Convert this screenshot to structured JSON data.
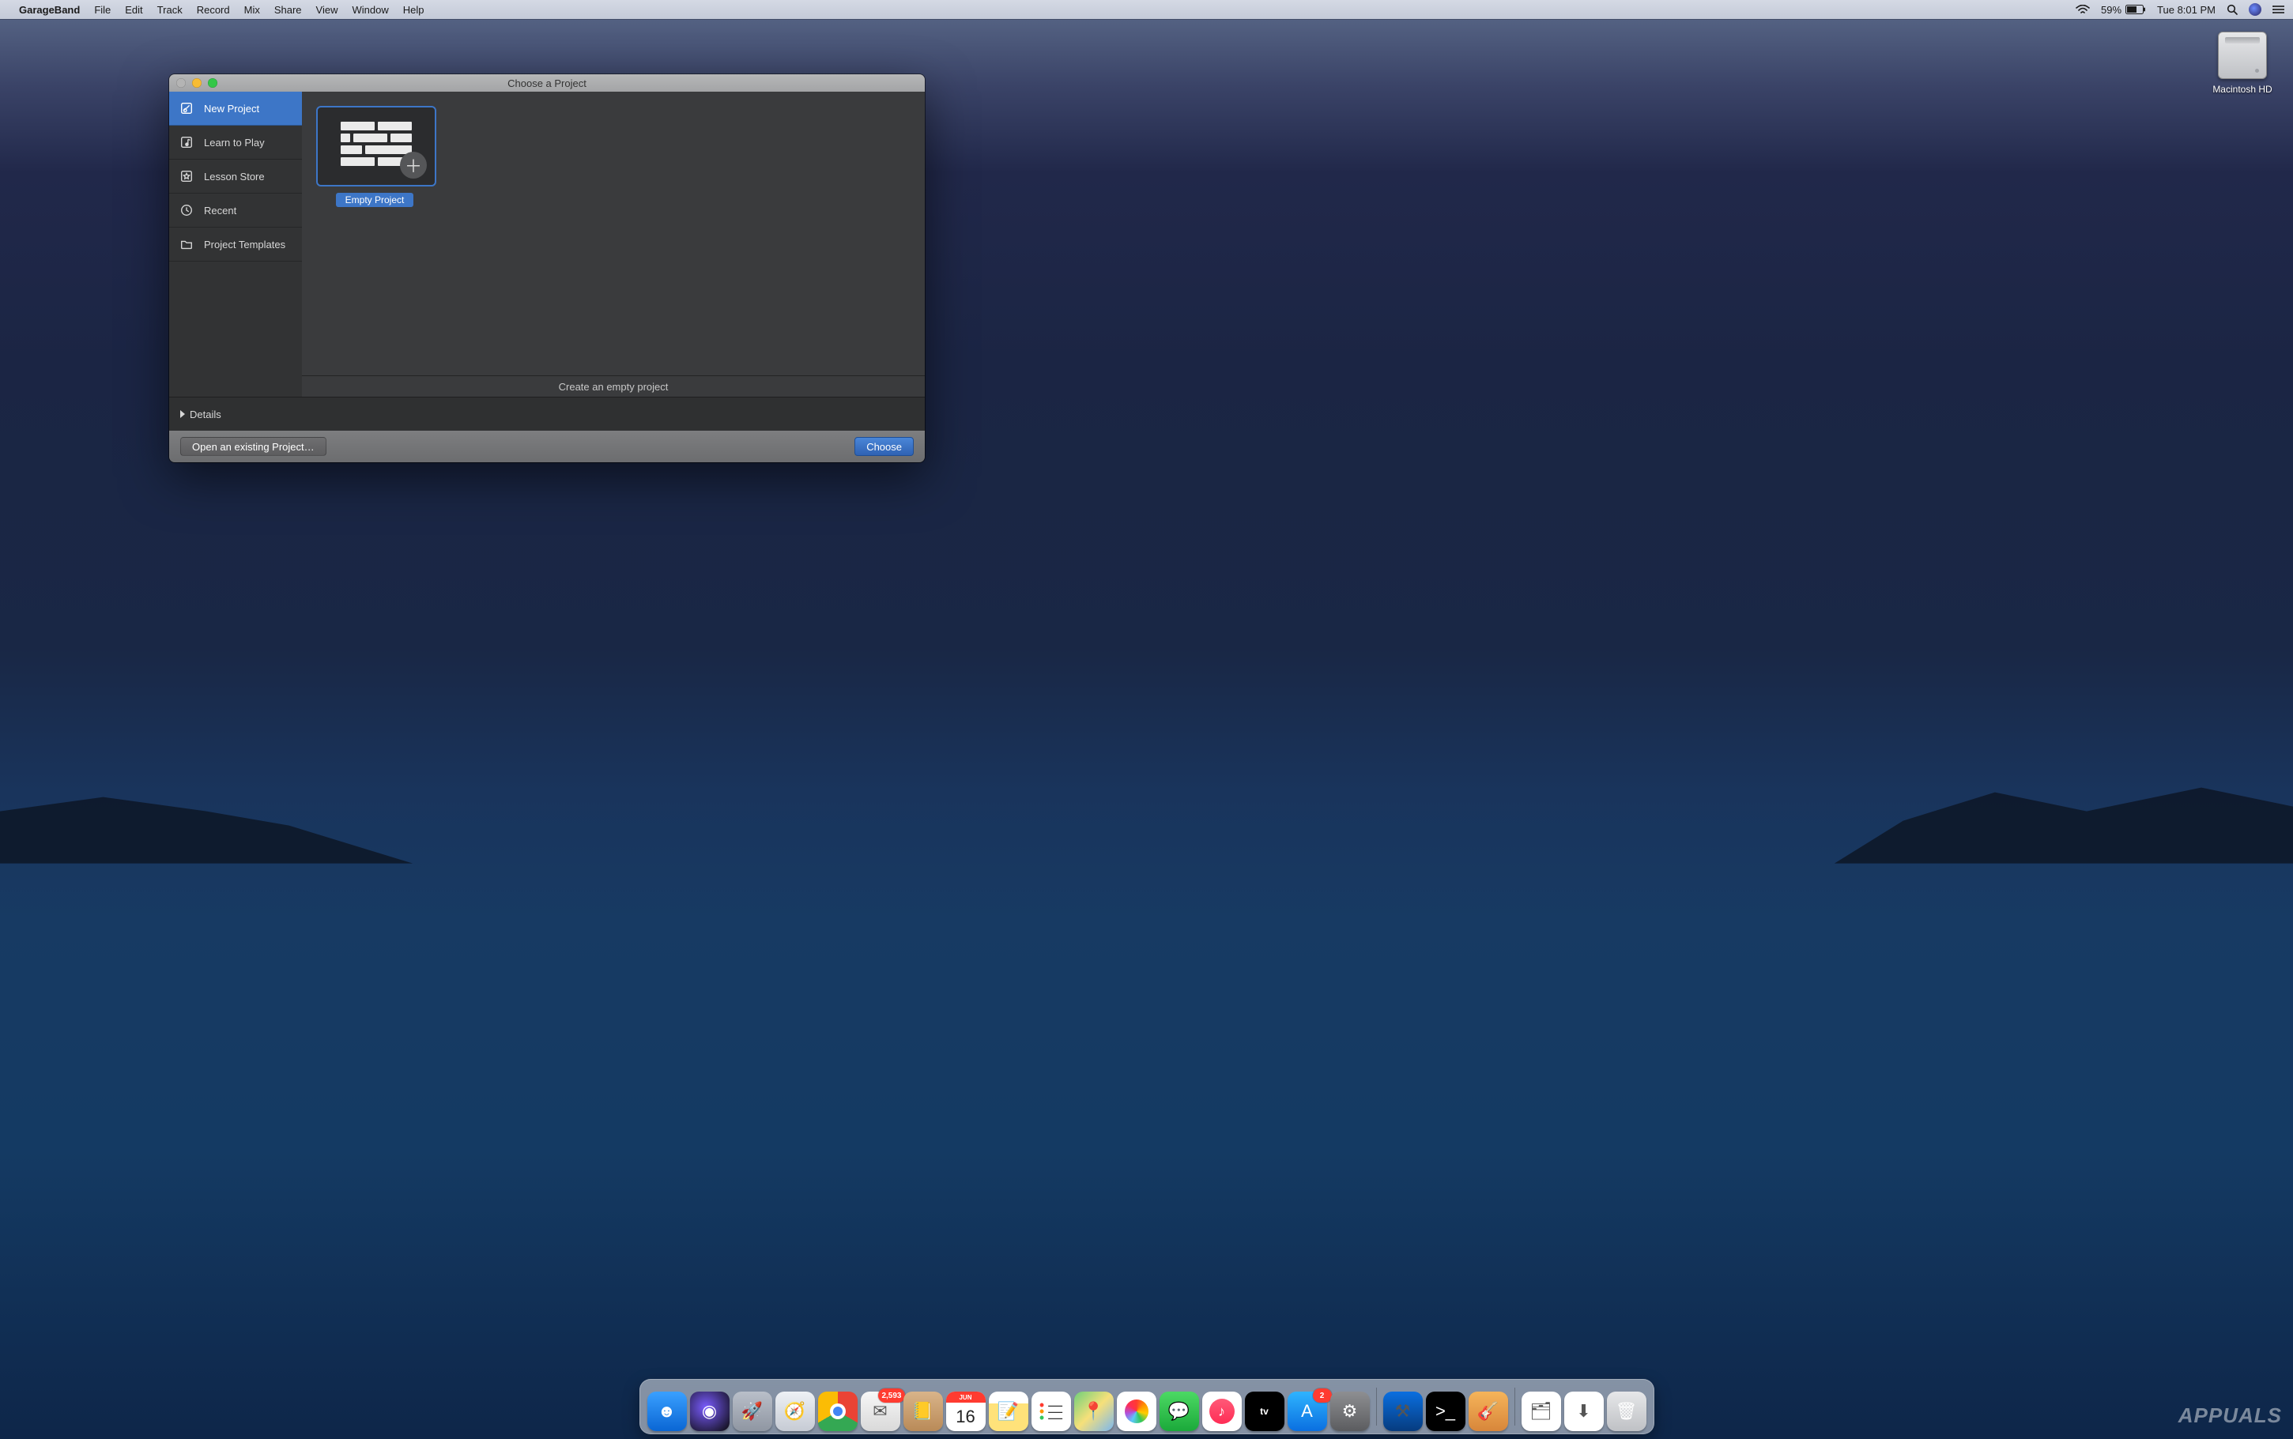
{
  "menubar": {
    "app_name": "GarageBand",
    "items": [
      "File",
      "Edit",
      "Track",
      "Record",
      "Mix",
      "Share",
      "View",
      "Window",
      "Help"
    ],
    "battery_percent": "59%",
    "clock": "Tue 8:01 PM"
  },
  "desktop": {
    "drive_label": "Macintosh HD"
  },
  "window": {
    "title": "Choose a Project",
    "sidebar": [
      {
        "icon": "guitar-icon",
        "label": "New Project",
        "selected": true
      },
      {
        "icon": "note-icon",
        "label": "Learn to Play",
        "selected": false
      },
      {
        "icon": "star-icon",
        "label": "Lesson Store",
        "selected": false
      },
      {
        "icon": "clock-icon",
        "label": "Recent",
        "selected": false
      },
      {
        "icon": "folder-icon",
        "label": "Project Templates",
        "selected": false
      }
    ],
    "gallery": {
      "empty_project_label": "Empty Project",
      "description": "Create an empty project"
    },
    "details_label": "Details",
    "open_existing_label": "Open an existing Project…",
    "choose_label": "Choose"
  },
  "dock": {
    "apps": [
      {
        "name": "finder",
        "bg": "linear-gradient(#3aa0ff,#0a66d4)",
        "glyph": "☻"
      },
      {
        "name": "siri",
        "bg": "radial-gradient(circle at 40% 40%,#7a5cff,#0a0a0a)",
        "glyph": "◉"
      },
      {
        "name": "launchpad",
        "bg": "linear-gradient(#b9bfc9,#8f96a2)",
        "glyph": "🚀"
      },
      {
        "name": "safari",
        "bg": "linear-gradient(#eef1f5,#c6cbd4)",
        "glyph": "🧭"
      },
      {
        "name": "chrome",
        "bg": "conic-gradient(#ea4335 0 120deg,#34a853 120deg 240deg,#fbbc05 240deg 360deg)",
        "glyph": "",
        "badge": ""
      },
      {
        "name": "mail",
        "bg": "linear-gradient(#f7f7f7,#d9d9d9)",
        "glyph": "✉︎",
        "badge": "2,593"
      },
      {
        "name": "contacts",
        "bg": "linear-gradient(#d9b48a,#b98a58)",
        "glyph": "📒"
      },
      {
        "name": "calendar",
        "bg": "#ffffff",
        "glyph": "",
        "cal_month": "JUN",
        "cal_day": "16"
      },
      {
        "name": "notes",
        "bg": "linear-gradient(#fff 0 30%,#ffe27a 30% 100%)",
        "glyph": "📝"
      },
      {
        "name": "reminders",
        "bg": "#ffffff",
        "glyph": "☰"
      },
      {
        "name": "maps",
        "bg": "linear-gradient(135deg,#6fd07a,#f6e07a 50%,#7ab7f0)",
        "glyph": "📍"
      },
      {
        "name": "photos",
        "bg": "#ffffff",
        "glyph": "❀"
      },
      {
        "name": "messages",
        "bg": "linear-gradient(#4cd964,#1ba93a)",
        "glyph": "💬"
      },
      {
        "name": "music",
        "bg": "#ffffff",
        "glyph": "♪"
      },
      {
        "name": "appletv",
        "bg": "#000000",
        "glyph": "tv"
      },
      {
        "name": "appstore",
        "bg": "linear-gradient(#2fb4ff,#0a6fe0)",
        "glyph": "A",
        "badge": "2"
      },
      {
        "name": "preferences",
        "bg": "linear-gradient(#8e8f92,#5b5c5f)",
        "glyph": "⚙︎"
      }
    ],
    "right": [
      {
        "name": "xcode",
        "bg": "linear-gradient(#0a6fe0,#063b7e)",
        "glyph": "⚒︎"
      },
      {
        "name": "terminal",
        "bg": "#000000",
        "glyph": ">_"
      },
      {
        "name": "garageband",
        "bg": "linear-gradient(#f5b45a,#d8863a)",
        "glyph": "🎸"
      }
    ],
    "stacks": [
      {
        "name": "documents",
        "bg": "#ffffff",
        "glyph": "🗂"
      },
      {
        "name": "downloads",
        "bg": "#ffffff",
        "glyph": "⬇︎"
      },
      {
        "name": "trash",
        "bg": "linear-gradient(#e6e7e9,#bfc1c5)",
        "glyph": "🗑"
      }
    ]
  },
  "watermark": "APPUALS"
}
